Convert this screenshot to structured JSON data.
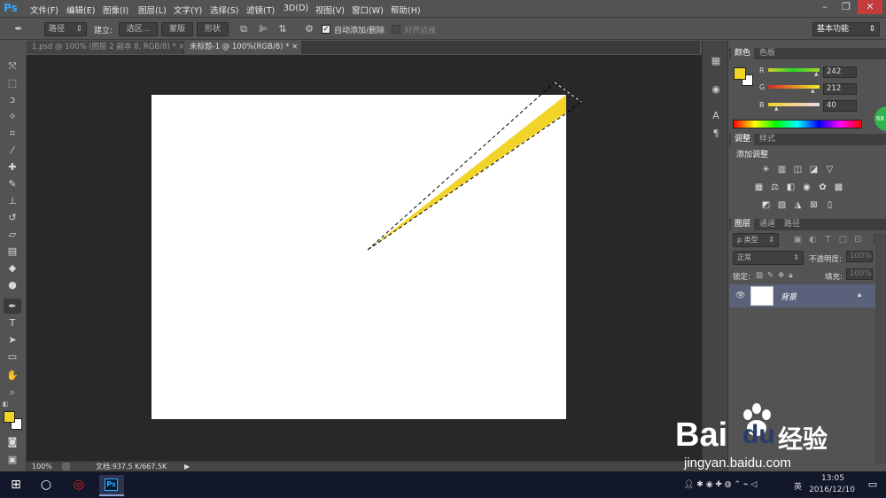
{
  "app": {
    "logo": "Ps"
  },
  "menu": [
    "文件(F)",
    "编辑(E)",
    "图像(I)",
    "图层(L)",
    "文字(Y)",
    "选择(S)",
    "滤镜(T)",
    "3D(D)",
    "视图(V)",
    "窗口(W)",
    "帮助(H)"
  ],
  "window_controls": {
    "minimize": "–",
    "restore": "❐",
    "close": "✕"
  },
  "options": {
    "mode": "路径",
    "make_label": "建立:",
    "selection_btn": "选区...",
    "mask_btn": "蒙版",
    "shape_btn": "形状",
    "auto_add_delete": "自动添加/删除",
    "align_edges": "对齐边缘",
    "workspace": "基本功能"
  },
  "tabs": [
    {
      "label": "1.psd @ 100% (图层 2 副本 8, RGB/8) *"
    },
    {
      "label": "未标题-1 @ 100%(RGB/8) *"
    }
  ],
  "status": {
    "zoom": "100%",
    "doc_info": "文档:937.5 K/667.5K"
  },
  "color_panel": {
    "tabs": [
      "颜色",
      "色板"
    ],
    "r_label": "R",
    "g_label": "G",
    "b_label": "B",
    "r": 242,
    "g": 212,
    "b": 40,
    "foreground": "#f2d428",
    "badge": "68"
  },
  "adjust_panel": {
    "tabs": [
      "调整",
      "样式"
    ],
    "title": "添加调整"
  },
  "layers_panel": {
    "tabs": [
      "图层",
      "通道",
      "路径"
    ],
    "filter_label": "ρ 类型",
    "blend_mode": "正常",
    "opacity_label": "不透明度:",
    "opacity": "100%",
    "lock_label": "锁定:",
    "fill_label": "填充:",
    "fill": "100%",
    "layer_name": "背景"
  },
  "taskbar": {
    "time": "13:05",
    "date": "2016/12/10",
    "ime": "英",
    "ps_label": "Ps"
  },
  "watermark": {
    "brand": "Bai",
    "brand2": "du",
    "cn": "经验",
    "url": "jingyan.baidu.com"
  }
}
